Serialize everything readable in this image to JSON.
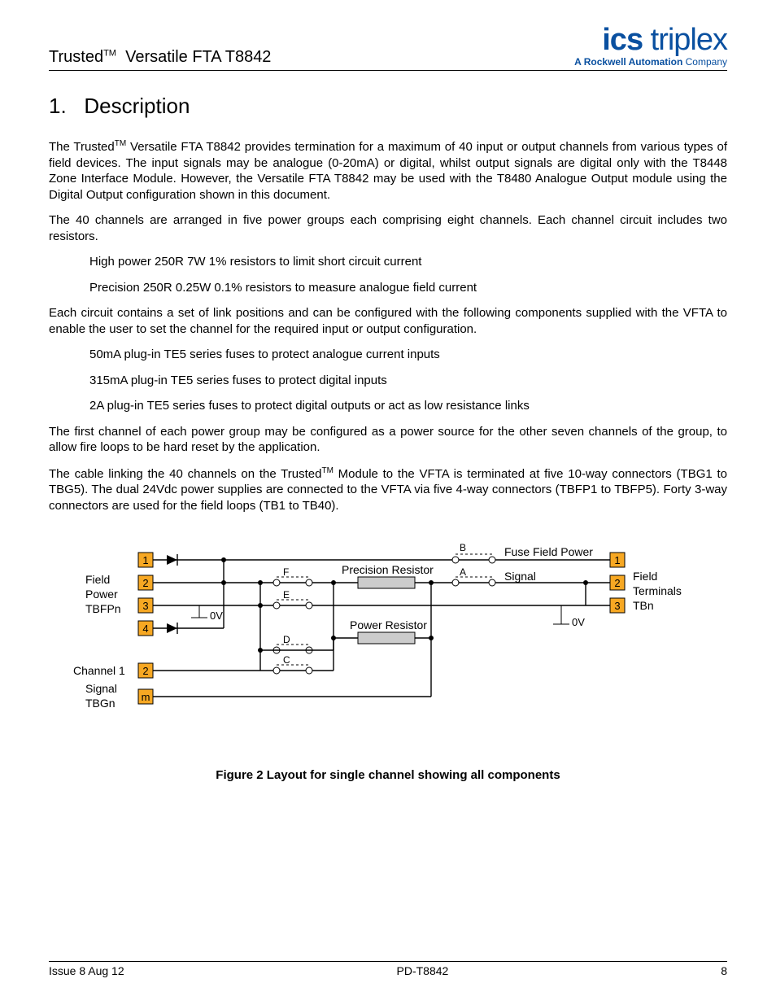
{
  "header": {
    "product_line": "Trusted",
    "tm": "TM",
    "product_name": "Versatile FTA T8842",
    "logo_ics": "ics",
    "logo_triplex": " triplex",
    "logo_sub_bold": "A Rockwell Automation",
    "logo_sub_rest": " Company"
  },
  "section": {
    "number": "1.",
    "title": "Description"
  },
  "paragraphs": {
    "p1a": "The Trusted",
    "p1b": " Versatile FTA T8842 provides termination for a maximum of 40 input or output channels from various types of field devices.  The input signals may be analogue (0-20mA) or digital, whilst output signals are digital only with the T8448 Zone Interface Module. However, the Versatile FTA T8842 may be used with the T8480 Analogue Output module using the Digital Output configuration shown in this document.",
    "p2": "The 40 channels are arranged in five power groups each comprising eight channels.  Each channel circuit includes two resistors.",
    "b1": "High power 250R 7W 1% resistors to limit short circuit current",
    "b2": "Precision 250R 0.25W 0.1% resistors to measure analogue field current",
    "p3": "Each circuit contains a set of link positions and can be configured with the following components supplied with the VFTA to enable the user to set the channel for the required input or output configuration.",
    "b3": "50mA plug-in TE5 series fuses to protect analogue current inputs",
    "b4": "315mA plug-in TE5 series fuses to protect digital inputs",
    "b5": "2A plug-in TE5 series fuses to protect digital outputs or act as low resistance links",
    "p4": "The first channel of each power group may be configured as a power source for the other seven channels of the group, to allow fire loops to be hard reset by the application.",
    "p5a": "The cable linking the 40 channels on the Trusted",
    "p5b": " Module to the VFTA is terminated at five 10-way connectors (TBG1 to TBG5). The dual 24Vdc power supplies are connected to the VFTA via five 4-way connectors (TBFP1 to TBFP5).  Forty 3-way connectors are used for the field loops (TB1 to TB40)."
  },
  "diagram": {
    "left_label_1": "Field",
    "left_label_2": "Power",
    "left_label_3": "TBFPn",
    "left_label_4": "Channel 1",
    "left_label_5": "Signal",
    "left_label_6": "TBGn",
    "right_label_1": "Field",
    "right_label_2": "Terminals",
    "right_label_3": "TBn",
    "top_fuse": "Fuse Field Power",
    "precision": "Precision Resistor",
    "power": "Power Resistor",
    "signal": "Signal",
    "zero_v": "0V",
    "nA": "A",
    "nB": "B",
    "nC": "C",
    "nD": "D",
    "nE": "E",
    "nF": "F",
    "t1": "1",
    "t2": "2",
    "t3": "3",
    "t4": "4",
    "tm": "m"
  },
  "figure_caption": "Figure 2 Layout for single channel showing all components",
  "footer": {
    "left": "Issue 8 Aug 12",
    "center": "PD-T8842",
    "right": "8"
  }
}
